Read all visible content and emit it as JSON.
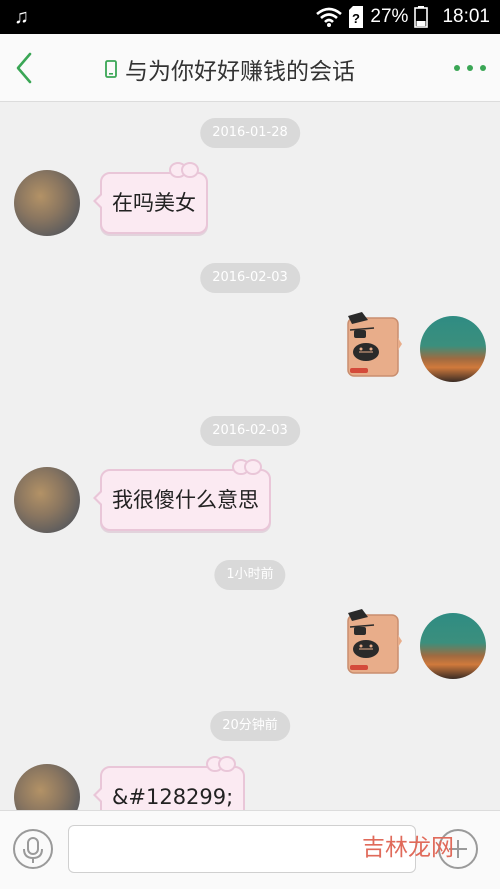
{
  "status_bar": {
    "music_icon": "music-note-icon",
    "battery_percent": "27%",
    "time": "18:01"
  },
  "header": {
    "title": "与为你好好赚钱的会话",
    "back_icon": "back-chevron-icon",
    "phone_icon": "mobile-phone-icon",
    "more_icon": "more-dots-icon",
    "accent_color": "#3aa655"
  },
  "messages": [
    {
      "type": "timestamp",
      "text": "2016-01-28"
    },
    {
      "type": "incoming",
      "text": "在吗美女"
    },
    {
      "type": "timestamp",
      "text": "2016-02-03"
    },
    {
      "type": "outgoing-sticker",
      "sticker": "pirate-robot-sticker"
    },
    {
      "type": "timestamp",
      "text": "2016-02-03"
    },
    {
      "type": "incoming",
      "text": "我很傻什么意思"
    },
    {
      "type": "timestamp",
      "text": "1小时前"
    },
    {
      "type": "outgoing-sticker",
      "sticker": "pirate-robot-sticker"
    },
    {
      "type": "timestamp",
      "text": "20分钟前"
    },
    {
      "type": "incoming",
      "text": "&#128299;"
    }
  ],
  "input_bar": {
    "voice_icon": "microphone-icon",
    "value": "",
    "plus_icon": "plus-icon"
  },
  "watermark": "吉林龙网"
}
